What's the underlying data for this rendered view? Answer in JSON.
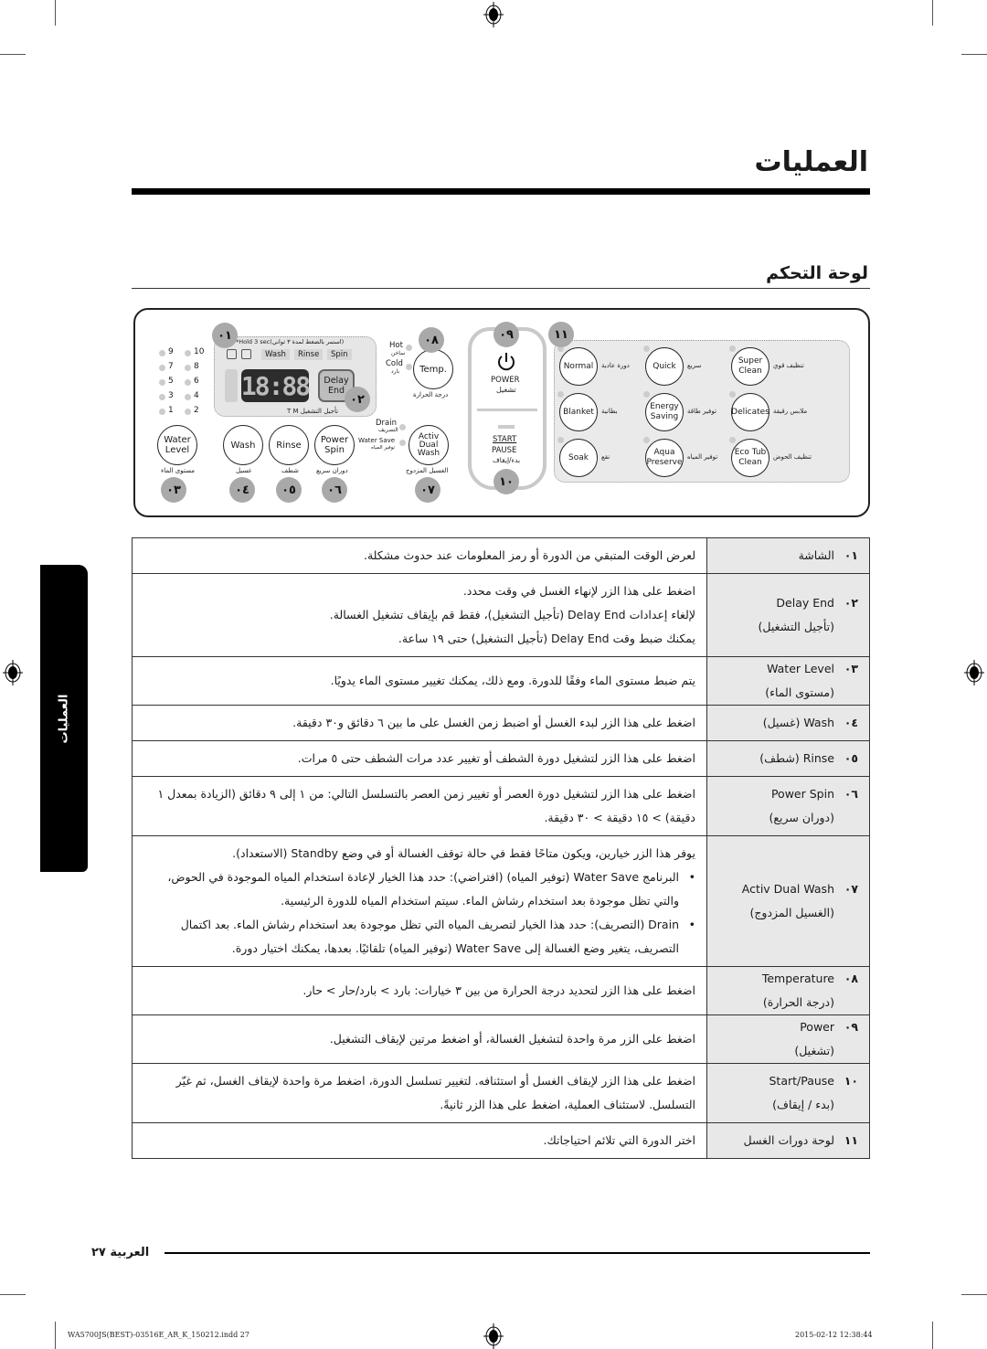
{
  "page": {
    "title": "العمليات",
    "section_title": "لوحة التحكم",
    "side_tab": "العمليات",
    "footer_label": "العربية ٢٧",
    "slug_left": "WA5700JS(BEST)-03516E_AR_K_150212.indd   27",
    "slug_right": "2015-02-12   12:38:44"
  },
  "panel": {
    "badges": [
      "٠١",
      "٠٢",
      "٠٣",
      "٠٤",
      "٠٥",
      "٠٦",
      "٠٧",
      "٠٨",
      "٠٩",
      "١٠",
      "١١"
    ],
    "water_levels": [
      "9",
      "10",
      "7",
      "8",
      "5",
      "6",
      "3",
      "4",
      "1",
      "2"
    ],
    "hold_note": "*Hold 3 sec(استمر بالضغط لمدة ٣ ثواني)",
    "display_tags": [
      "Wash",
      "Rinse",
      "Spin"
    ],
    "display_digits": "18:88",
    "delay_end": "Delay End",
    "display_bottom": "T   M   تأجيل التشغيل",
    "hot": "Hot",
    "hot_ar": "ساخن",
    "cold": "Cold",
    "cold_ar": "بارد",
    "temp": "Temp.",
    "temp_ar": "درجة الحرارة",
    "drain": "Drain",
    "drain_ar": "التصريف",
    "water_save": "Water Save",
    "water_save_ar": "توفير المياه",
    "activ": "Activ Dual Wash",
    "activ_ar": "الغسيل المزدوج",
    "water_level": "Water Level",
    "water_level_ar": "مستوى الماء",
    "wash": "Wash",
    "wash_ar": "غسيل",
    "rinse": "Rinse",
    "rinse_ar": "شطف",
    "power_spin": "Power Spin",
    "power_spin_ar": "دوران سريع",
    "power": "POWER",
    "power_ar": "تشغيل",
    "start": "START",
    "pause": "PAUSE",
    "start_ar": "بدء/إيقاف",
    "cycles": [
      {
        "en": "Normal",
        "ar": "دورة عادية"
      },
      {
        "en": "Quick",
        "ar": "سريع"
      },
      {
        "en": "Super Clean",
        "ar": "تنظيف قوي"
      },
      {
        "en": "Blanket",
        "ar": "بطانية"
      },
      {
        "en": "Energy Saving",
        "ar": "توفير طاقة"
      },
      {
        "en": "Delicates",
        "ar": "ملابس رقيقة"
      },
      {
        "en": "Soak",
        "ar": "نقع"
      },
      {
        "en": "Aqua Preserve",
        "ar": "توفير المياه"
      },
      {
        "en": "Eco Tub Clean",
        "ar": "تنظيف الحوض"
      }
    ]
  },
  "table": {
    "rows": [
      {
        "num": "٠١",
        "name": "الشاشة",
        "name2": "",
        "desc": [
          "لعرض الوقت المتبقي من الدورة أو رمز المعلومات عند حدوث مشكلة."
        ]
      },
      {
        "num": "٠٢",
        "name": "Delay End",
        "name2": "(تأجيل التشغيل)",
        "desc": [
          "اضغط على هذا الزر لإنهاء الغسل في وقت محدد.",
          "لإلغاء إعدادات Delay End (تأجيل التشغيل)، فقط قم بإيقاف تشغيل الغسالة.",
          "يمكنك ضبط وقت Delay End (تأجيل التشغيل) حتى ١٩ ساعة."
        ]
      },
      {
        "num": "٠٣",
        "name": "Water Level",
        "name2": "(مستوى الماء)",
        "desc": [
          "يتم ضبط مستوى الماء وفقًا للدورة. ومع ذلك، يمكنك تغيير مستوى الماء يدويًا."
        ]
      },
      {
        "num": "٠٤",
        "name": "Wash (غسيل)",
        "name2": "",
        "desc": [
          "اضغط على هذا الزر لبدء الغسل أو اضبط زمن الغسل على ما بين ٦ دقائق و٣٠ دقيقة."
        ]
      },
      {
        "num": "٠٥",
        "name": "Rinse (شطف)",
        "name2": "",
        "desc": [
          "اضغط على هذا الزر لتشغيل دورة الشطف أو تغيير عدد مرات الشطف حتى ٥ مرات."
        ]
      },
      {
        "num": "٠٦",
        "name": "Power Spin",
        "name2": "(دوران سريع)",
        "desc": [
          "اضغط على هذا الزر لتشغيل دورة العصر أو تغيير زمن العصر بالتسلسل التالي: من ١ إلى ٩ دقائق (الزيادة بمعدل ١ دقيقة) > ١٥ دقيقة > ٣٠ دقيقة."
        ]
      },
      {
        "num": "٠٧",
        "name": "Activ Dual Wash",
        "name2": "(الغسيل المزدوج)",
        "desc": [
          "يوفر هذا الزر خيارين، ويكون متاحًا فقط في حالة توقف الغسالة أو في وضع Standby (الاستعداد)."
        ],
        "bullets": [
          "البرنامج Water Save (توفير المياه) (افتراضي): حدد هذا الخيار لإعادة استخدام المياه الموجودة في الحوض، والتي تظل موجودة بعد استخدام رشاش الماء. سيتم استخدام المياه للدورة الرئيسية.",
          "Drain (التصريف): حدد هذا الخيار لتصريف المياه التي تظل موجودة بعد استخدام رشاش الماء. بعد اكتمال التصريف، يتغير وضع الغسالة إلى Water Save (توفير المياه) تلقائيًا. بعدها، يمكنك اختيار دورة."
        ]
      },
      {
        "num": "٠٨",
        "name": "Temperature",
        "name2": "(درجة الحرارة)",
        "desc": [
          "اضغط على هذا الزر لتحديد درجة الحرارة من بين ٣ خيارات: بارد > بارد/حار > حار."
        ]
      },
      {
        "num": "٠٩",
        "name": "Power",
        "name2": "(تشغيل)",
        "desc": [
          "اضغط على الزر مرة واحدة لتشغيل الغسالة، أو اضغط مرتين لإيقاف التشغيل."
        ]
      },
      {
        "num": "١٠",
        "name": "Start/Pause",
        "name2": "(بدء / إيقاف)",
        "desc": [
          "اضغط على هذا الزر لإيقاف الغسل أو استئنافه. لتغيير تسلسل الدورة، اضغط مرة واحدة لإيقاف الغسل، ثم غيّر التسلسل. لاستئناف العملية، اضغط على هذا الزر ثانيةً."
        ]
      },
      {
        "num": "١١",
        "name": "لوحة دورات الغسل",
        "name2": "",
        "desc": [
          "اختر الدورة التي تلائم احتياجاتك."
        ]
      }
    ]
  }
}
